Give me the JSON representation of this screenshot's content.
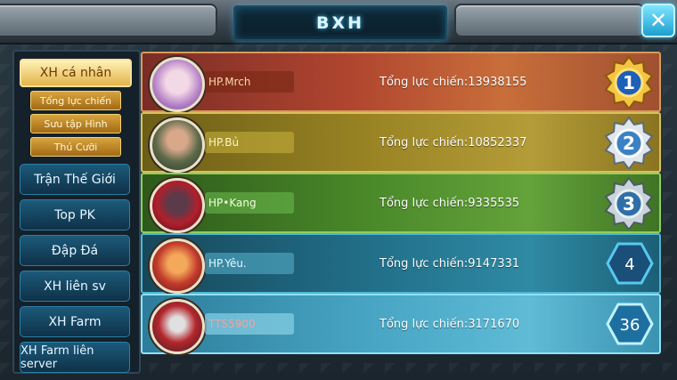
{
  "header": {
    "title": "BXH",
    "close_icon": "close-icon"
  },
  "menu": {
    "main_tab": "XH cá nhân",
    "sub_tabs": [
      "Tổng lực chiến",
      "Sưu tập Hình",
      "Thú Cưỡi"
    ],
    "tabs": [
      "Trận Thế Giới",
      "Top PK",
      "Đập Đá",
      "XH liên sv",
      "XH Farm",
      "XH Farm liên server"
    ]
  },
  "rows": [
    {
      "rank": "1",
      "name": "HP.Mrch",
      "power": "Tổng lực chiến:13938155",
      "rank_style": "gold-medal"
    },
    {
      "rank": "2",
      "name": "HP.Bủ",
      "power": "Tổng lực chiến:10852337",
      "rank_style": "silver-medal"
    },
    {
      "rank": "3",
      "name": "HP•Kang",
      "power": "Tổng lực chiến:9335535",
      "rank_style": "bronze-medal"
    },
    {
      "rank": "4",
      "name": "HP.Yêu.",
      "power": "Tổng lực chiến:9147331",
      "rank_style": "hexagon"
    },
    {
      "rank": "36",
      "name": "TTS5900",
      "power": "Tổng lực chiến:3171670",
      "rank_style": "hexagon"
    }
  ],
  "colors": {
    "accent": "#3fc3ff",
    "gold": "#e2b34a"
  }
}
